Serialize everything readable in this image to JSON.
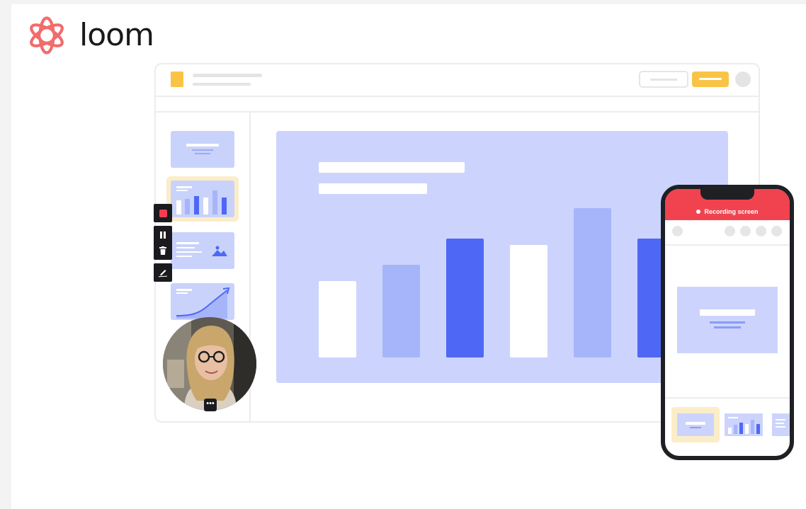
{
  "brand": {
    "name": "loom",
    "color": "#f26b6b"
  },
  "phone": {
    "recording_label": "Recording screen"
  },
  "webcam": {
    "more_label": "•••"
  },
  "colors": {
    "accent_yellow": "#f9c446",
    "slide_bg": "#ccd4fd",
    "bar_light": "#a6b5fa",
    "bar_dark": "#4e68f5",
    "record_red": "#f0434f"
  }
}
